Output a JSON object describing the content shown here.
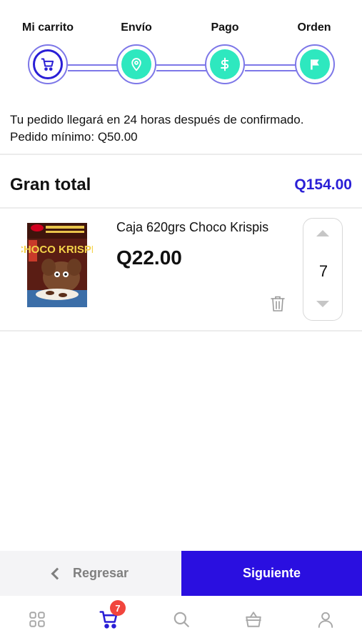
{
  "stepper": {
    "steps": [
      {
        "label": "Mi carrito",
        "icon": "cart-icon",
        "state": "active"
      },
      {
        "label": "Envío",
        "icon": "location-pin-icon",
        "state": "pending"
      },
      {
        "label": "Pago",
        "icon": "dollar-icon",
        "state": "pending"
      },
      {
        "label": "Orden",
        "icon": "flag-icon",
        "state": "pending"
      }
    ]
  },
  "info": {
    "line1": "Tu pedido llegará en 24 horas después de confirmado.",
    "line2": "Pedido mínimo: Q50.00"
  },
  "total": {
    "label": "Gran total",
    "value": "Q154.00"
  },
  "cart": {
    "items": [
      {
        "name": "Caja 620grs Choco Krispis",
        "price": "Q22.00",
        "quantity": "7",
        "image": "choco-krispis-box-image",
        "image_brand_text": "CHOCO KRISPIS"
      }
    ]
  },
  "actions": {
    "back_label": "Regresar",
    "next_label": "Siguiente"
  },
  "tabbar": {
    "tabs": [
      {
        "icon": "grid-icon"
      },
      {
        "icon": "cart-icon",
        "badge": "7"
      },
      {
        "icon": "search-icon"
      },
      {
        "icon": "shopping-bag-icon"
      },
      {
        "icon": "user-icon"
      }
    ]
  },
  "colors": {
    "primary": "#2a0fe0",
    "accent": "#2ee8bf",
    "line": "#7d77e8",
    "badge": "#f1453d"
  }
}
